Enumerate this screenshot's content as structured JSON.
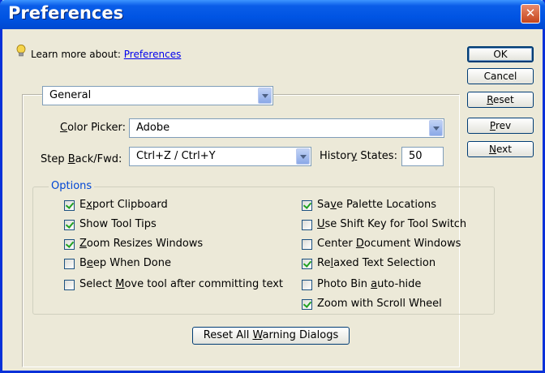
{
  "window": {
    "title": "Preferences"
  },
  "learn_more": {
    "prefix": "Learn more about:",
    "link": "Preferences"
  },
  "buttons": {
    "ok": "OK",
    "cancel": "Cancel",
    "reset": "Reset",
    "prev": "Prev",
    "next": "Next"
  },
  "section_select": {
    "value": "General"
  },
  "color_picker": {
    "label": "Color Picker:",
    "value": "Adobe"
  },
  "step_back": {
    "label": "Step Back/Fwd:",
    "value": "Ctrl+Z / Ctrl+Y"
  },
  "history_states": {
    "label": "History States:",
    "value": "50"
  },
  "options": {
    "title": "Options",
    "left": [
      {
        "label": "Export Clipboard",
        "checked": true
      },
      {
        "label": "Show Tool Tips",
        "checked": true
      },
      {
        "label": "Zoom Resizes Windows",
        "checked": true
      },
      {
        "label": "Beep When Done",
        "checked": false
      },
      {
        "label": "Select Move tool after committing text",
        "checked": false
      }
    ],
    "right": [
      {
        "label": "Save Palette Locations",
        "checked": true
      },
      {
        "label": "Use Shift Key for Tool Switch",
        "checked": false
      },
      {
        "label": "Center Document Windows",
        "checked": false
      },
      {
        "label": "Relaxed Text Selection",
        "checked": true
      },
      {
        "label": "Photo Bin auto-hide",
        "checked": false
      },
      {
        "label": "Zoom with Scroll Wheel",
        "checked": true
      }
    ]
  },
  "reset_warnings": {
    "label": "Reset All Warning Dialogs"
  }
}
